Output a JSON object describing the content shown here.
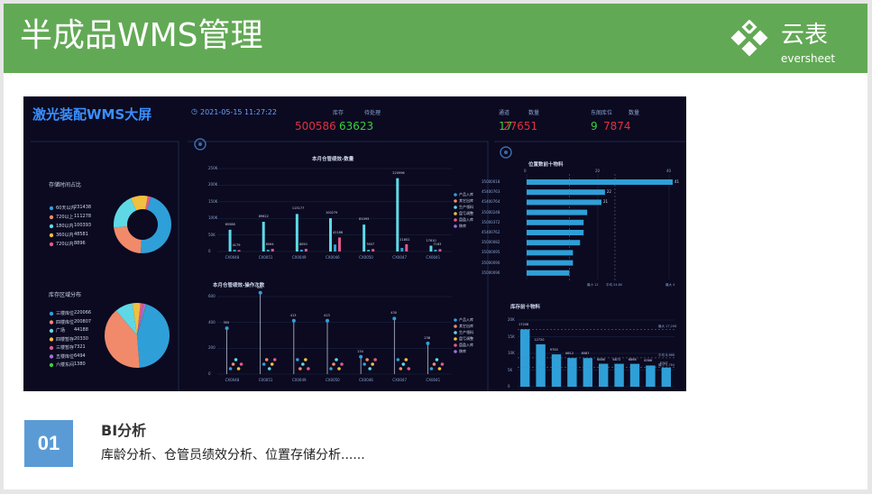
{
  "slide": {
    "title": "半成品WMS管理",
    "logo_cn": "云表",
    "logo_en": "eversheet",
    "section_number": "01",
    "section_title": "BI分析",
    "section_desc": "库龄分析、仓管员绩效分析、位置存储分析......"
  },
  "dashboard": {
    "title": "激光装配WMS大屏",
    "datetime": "2021-05-15 11:27:22",
    "kpis": [
      {
        "label": "库存",
        "value": "500586",
        "color": "#e03040"
      },
      {
        "label": "待处理",
        "value": "63623",
        "color": "#3ccf3c"
      },
      {
        "label": "通道",
        "value": "17",
        "color": "#3ccf3c"
      },
      {
        "label": "数量",
        "value": "27651",
        "color": "#e03040"
      },
      {
        "label": "东阁库位",
        "value": "9",
        "color": "#3ccf3c"
      },
      {
        "label": "数量",
        "value": "7874",
        "color": "#e03040"
      }
    ],
    "age_pie": {
      "title": "存储时间占比",
      "items": [
        {
          "label": "60天以内",
          "value": "231438",
          "color": "#2f9fd8"
        },
        {
          "label": "720以上",
          "value": "111278",
          "color": "#f08a6a"
        },
        {
          "label": "180以内",
          "value": "100393",
          "color": "#5fd8e6"
        },
        {
          "label": "360以内",
          "value": "48581",
          "color": "#f0c040"
        },
        {
          "label": "720以内",
          "value": "8896",
          "color": "#e05a8a"
        }
      ]
    },
    "area_pie": {
      "title": "库存区域分布",
      "items": [
        {
          "label": "三楼库位",
          "value": "220066",
          "color": "#2f9fd8"
        },
        {
          "label": "四楼库位",
          "value": "200807",
          "color": "#f08a6a"
        },
        {
          "label": "广场",
          "value": "44188",
          "color": "#5fd8e6"
        },
        {
          "label": "四楼暂存",
          "value": "20330",
          "color": "#f0c040"
        },
        {
          "label": "三楼暂存",
          "value": "7321",
          "color": "#e05a8a"
        },
        {
          "label": "五楼库位",
          "value": "6494",
          "color": "#a070e0"
        },
        {
          "label": "六楼东间",
          "value": "1380",
          "color": "#3ccf3c"
        }
      ]
    },
    "bar_chart": {
      "title": "本月仓管绩效-数量",
      "y_ticks": [
        "250K",
        "200K",
        "150K",
        "100K",
        "50K",
        "0"
      ],
      "categories": [
        "CX0048",
        "CX0051",
        "CX0049",
        "CX0046",
        "CX0050",
        "CX0047",
        "CX0041"
      ],
      "legend": [
        "产品入库",
        "其它出库",
        "生产领料",
        "盘亏调整",
        "盘盈入库",
        "移库"
      ],
      "legend_colors": [
        "#2f9fd8",
        "#f08a6a",
        "#5fd8e6",
        "#f0c040",
        "#e05a8a",
        "#a070e0"
      ],
      "main_values": [
        65588,
        89622,
        113177,
        100279,
        81093,
        220996,
        17610
      ],
      "main_labels": [
        "65588",
        "89622",
        "113177",
        "100279",
        "81093",
        "220996",
        "17610"
      ],
      "second_values": [
        4179,
        8064,
        8050,
        42188,
        7607,
        21802,
        7163
      ],
      "second_labels": [
        "4179",
        "8064",
        "8050",
        "42188",
        "7607",
        "21802",
        "7163"
      ]
    },
    "lollipop_chart": {
      "title": "本月仓管绩效-操作次数",
      "y_ticks": [
        "600",
        "400",
        "200",
        "0"
      ],
      "categories": [
        "CX0048",
        "CX0051",
        "CX0049",
        "CX0050",
        "CX0046",
        "CX0047",
        "CX0041"
      ],
      "legend": [
        "产品入库",
        "其它出库",
        "生产领料",
        "盘亏调整",
        "盘盈入库",
        "移库"
      ],
      "values": [
        355,
        630,
        413,
        413,
        134,
        430,
        238
      ],
      "labels": [
        "355",
        "630",
        "413",
        "413",
        "134",
        "430",
        "238"
      ]
    },
    "position_chart": {
      "title": "位置数前十物料",
      "x_ticks": [
        "0",
        "20",
        "40"
      ],
      "categories": [
        "35000018",
        "45400763",
        "45400764",
        "35000248",
        "35000372",
        "45400762",
        "35000082",
        "35000095",
        "35000090",
        "35000096"
      ],
      "values": [
        41,
        22,
        21,
        17,
        16,
        16,
        15,
        13,
        13,
        12
      ],
      "value_labels": [
        "41",
        "22",
        "21",
        "",
        "",
        "",
        "",
        "",
        "",
        ""
      ],
      "footer": [
        "最小 12",
        "平均 24.80",
        "最大 4"
      ]
    },
    "stock_chart": {
      "title": "库存前十物料",
      "y_ticks": [
        "20K",
        "15K",
        "10K",
        "5K",
        "0"
      ],
      "values": [
        17208,
        12720,
        9700,
        8612,
        8587,
        6886,
        6872,
        6866,
        6366,
        5747
      ],
      "labels": [
        "17208",
        "12720",
        "9700",
        "8612",
        "8587",
        "6886",
        "6872",
        "6866",
        "6366",
        "5747"
      ],
      "markers": [
        "最大 17,208",
        "平均 8,666",
        "最小 5,784"
      ]
    }
  }
}
